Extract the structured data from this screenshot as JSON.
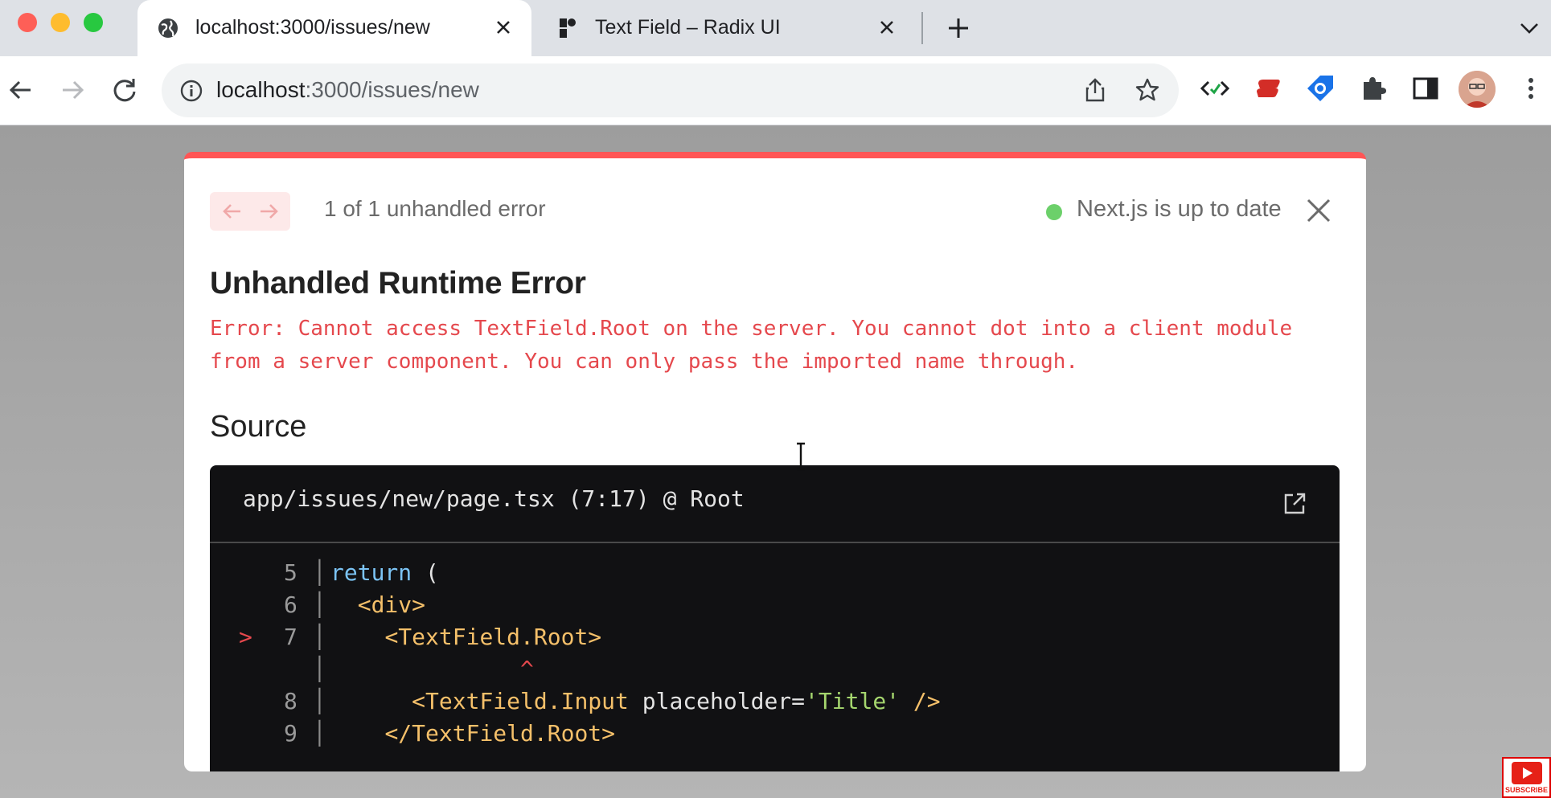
{
  "browser": {
    "tabs": [
      {
        "title": "localhost:3000/issues/new",
        "icon": "globe-icon",
        "active": true
      },
      {
        "title": "Text Field – Radix UI",
        "icon": "radix-logo-icon",
        "active": false
      }
    ],
    "url_host": "localhost",
    "url_rest": ":3000/issues/new",
    "extensions": [
      "code-extension-icon",
      "lastpass-icon",
      "tag-extension-icon",
      "puzzle-icon",
      "sidepanel-icon"
    ]
  },
  "overlay": {
    "error_count": "1 of 1 unhandled error",
    "status": "Next.js is up to date",
    "status_color": "#6cd06a",
    "title": "Unhandled Runtime Error",
    "message": "Error: Cannot access TextField.Root on the server. You cannot dot into a client module from a server component. You can only pass the imported name through.",
    "source_heading": "Source",
    "source_file": "app/issues/new/page.tsx (7:17) @ Root",
    "accent_color": "#ff5555",
    "code_lines": [
      {
        "num": "5",
        "marker": "",
        "parts": [
          {
            "cls": "kw",
            "text": "return"
          },
          {
            "cls": "plain",
            "text": " ("
          }
        ]
      },
      {
        "num": "6",
        "marker": "",
        "parts": [
          {
            "cls": "plain",
            "text": "  "
          },
          {
            "cls": "tag",
            "text": "<div>"
          }
        ]
      },
      {
        "num": "7",
        "marker": ">",
        "parts": [
          {
            "cls": "plain",
            "text": "    "
          },
          {
            "cls": "tag",
            "text": "<TextField.Root>"
          }
        ]
      },
      {
        "num": "",
        "marker": "",
        "parts": [
          {
            "cls": "caret",
            "text": "              ^"
          }
        ]
      },
      {
        "num": "8",
        "marker": "",
        "parts": [
          {
            "cls": "plain",
            "text": "      "
          },
          {
            "cls": "tag",
            "text": "<TextField.Input"
          },
          {
            "cls": "attr",
            "text": " placeholder="
          },
          {
            "cls": "str",
            "text": "'Title'"
          },
          {
            "cls": "tag",
            "text": " />"
          }
        ]
      },
      {
        "num": "9",
        "marker": "",
        "parts": [
          {
            "cls": "plain",
            "text": "    "
          },
          {
            "cls": "tag",
            "text": "</TextField.Root>"
          }
        ]
      }
    ]
  },
  "youtube_badge": "SUBSCRIBE"
}
